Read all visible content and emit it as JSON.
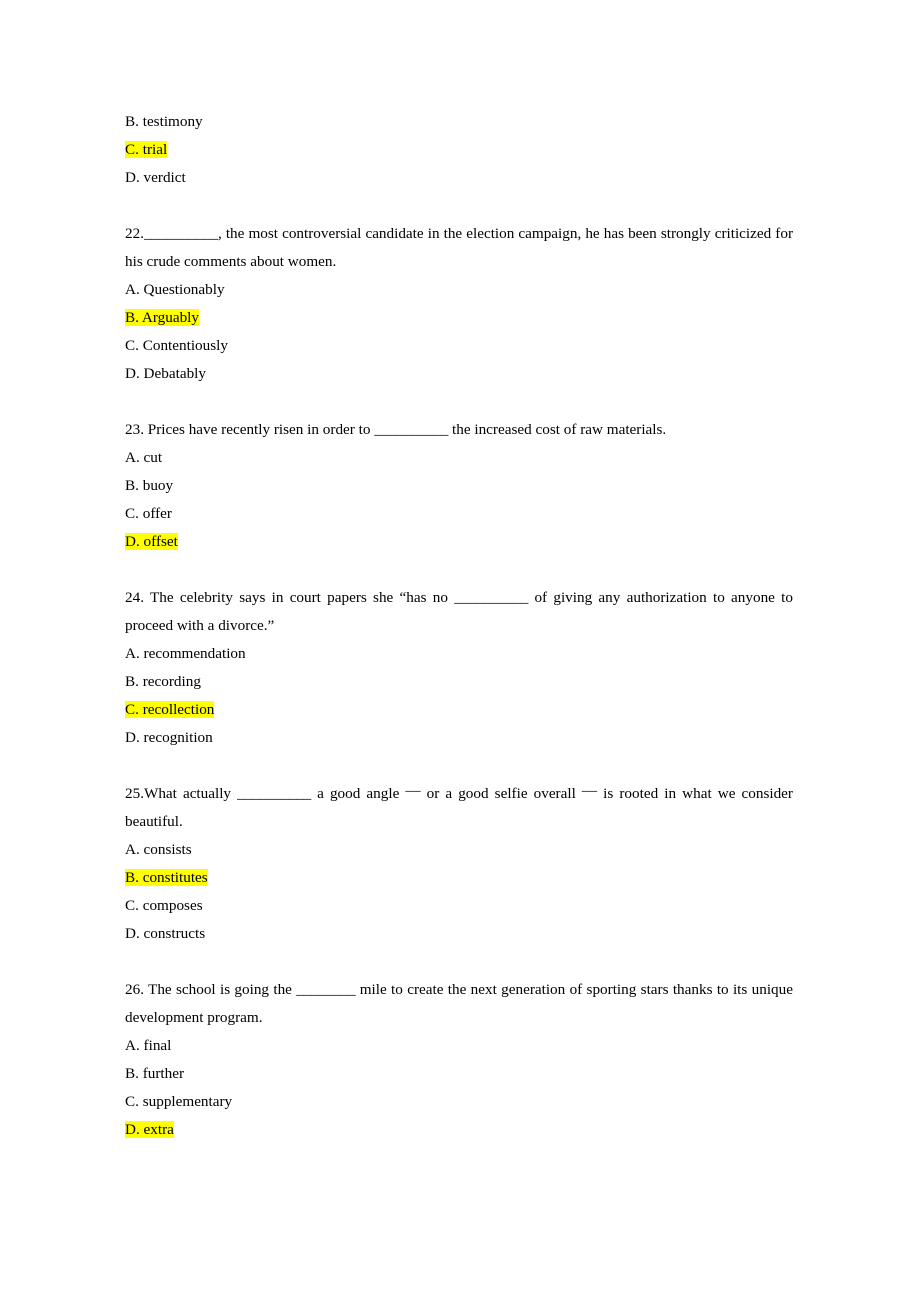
{
  "document": {
    "kind": "multiple-choice vocabulary test",
    "page_background": "#ffffff",
    "text_color": "#000000",
    "highlight_color": "#ffff00"
  },
  "continued_question": {
    "note": "tail of the previous question, options B through D",
    "options": [
      {
        "letter": "B.",
        "text": "B. testimony",
        "highlighted": false
      },
      {
        "letter": "C.",
        "text": "C. trial",
        "highlighted": true
      },
      {
        "letter": "D.",
        "text": "D. verdict",
        "highlighted": false
      }
    ]
  },
  "questions": [
    {
      "number": "22.",
      "stem_parts": {
        "lead": "22.",
        "blank": "__________",
        "rest": ", the most controversial candidate in the election campaign, he has been strongly criticized for his crude comments about women."
      },
      "stem_plain": "22.__________, the most controversial candidate in the election campaign, he has been strongly criticized for his crude comments about women.",
      "options": [
        {
          "letter": "A.",
          "text": "A. Questionably",
          "highlighted": false
        },
        {
          "letter": "B.",
          "text": "B. Arguably",
          "highlighted": true
        },
        {
          "letter": "C.",
          "text": "C. Contentiously",
          "highlighted": false
        },
        {
          "letter": "D.",
          "text": "D. Debatably",
          "highlighted": false
        }
      ],
      "answer": "B"
    },
    {
      "number": "23.",
      "stem_parts": {
        "lead": "23. Prices have recently risen in order to ",
        "blank": "__________",
        "rest": " the increased cost of raw materials."
      },
      "stem_plain": "23. Prices have recently risen in order to __________ the increased cost of raw materials.",
      "options": [
        {
          "letter": "A.",
          "text": "A. cut",
          "highlighted": false
        },
        {
          "letter": "B.",
          "text": "B. buoy",
          "highlighted": false
        },
        {
          "letter": "C.",
          "text": "C. offer",
          "highlighted": false
        },
        {
          "letter": "D.",
          "text": "D. offset",
          "highlighted": true
        }
      ],
      "answer": "D"
    },
    {
      "number": "24.",
      "stem_parts": {
        "lead": "24. The celebrity says in court papers she “has no ",
        "blank": "__________",
        "rest": " of giving any authorization to anyone to proceed with a divorce.”"
      },
      "stem_plain": "24. The celebrity says in court papers she “has no __________ of giving any authorization to anyone to proceed with a divorce.”",
      "options": [
        {
          "letter": "A.",
          "text": "A. recommendation",
          "highlighted": false
        },
        {
          "letter": "B.",
          "text": "B. recording",
          "highlighted": false
        },
        {
          "letter": "C.",
          "text": "C. recollection",
          "highlighted": true
        },
        {
          "letter": "D.",
          "text": "D. recognition",
          "highlighted": false
        }
      ],
      "answer": "C"
    },
    {
      "number": "25.",
      "stem_parts": {
        "lead": "25.What actually ",
        "blank": "__________",
        "mid1": " a good angle ",
        "dash1": "—",
        "mid2": " or a good selfie overall ",
        "dash2": "—",
        "rest": " is rooted in what we consider beautiful."
      },
      "stem_plain": "25.What actually __________ a good angle — or a good selfie overall — is rooted in what we consider beautiful.",
      "options": [
        {
          "letter": "A.",
          "text": "A. consists",
          "highlighted": false
        },
        {
          "letter": "B.",
          "text": "B. constitutes",
          "highlighted": true
        },
        {
          "letter": "C.",
          "text": "C. composes",
          "highlighted": false
        },
        {
          "letter": "D.",
          "text": "D. constructs",
          "highlighted": false
        }
      ],
      "answer": "B"
    },
    {
      "number": "26.",
      "stem_parts": {
        "lead": "26. The school is going the ",
        "blank": "________",
        "rest": " mile to create the next generation of sporting stars thanks to its unique development program."
      },
      "stem_plain": "26. The school is going the ________ mile to create the next generation of sporting stars thanks to its unique development program.",
      "options": [
        {
          "letter": "A.",
          "text": "A. final",
          "highlighted": false
        },
        {
          "letter": "B.",
          "text": "B. further",
          "highlighted": false
        },
        {
          "letter": "C.",
          "text": "C. supplementary",
          "highlighted": false
        },
        {
          "letter": "D.",
          "text": "D. extra",
          "highlighted": true
        }
      ],
      "answer": "D"
    }
  ]
}
